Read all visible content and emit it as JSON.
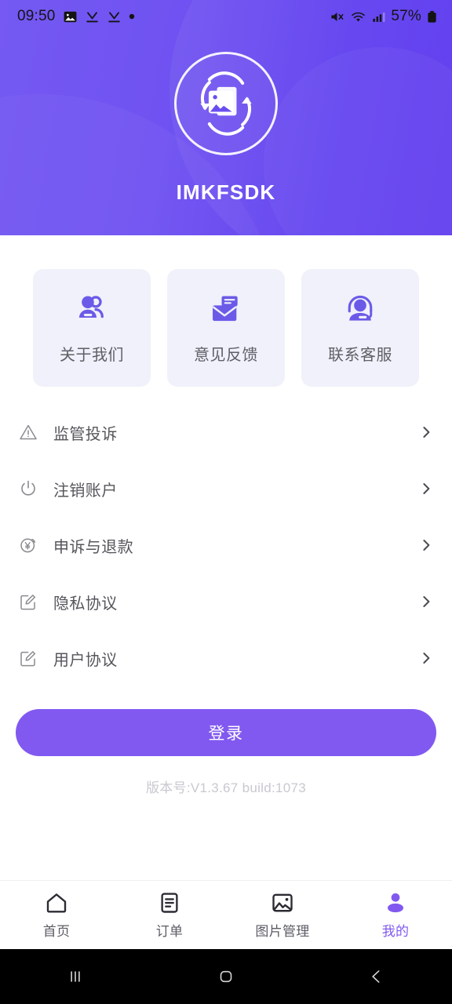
{
  "status_bar": {
    "clock": "09:50",
    "battery_text": "57%",
    "icons": [
      "image-icon",
      "download-check-icon",
      "download-check-icon",
      "dot-icon",
      "mute-icon",
      "wifi-icon",
      "signal-icon",
      "battery-icon"
    ]
  },
  "header": {
    "app_title": "IMKFSDK",
    "logo_icon": "photo-recovery-icon",
    "gradient_from": "#7559f2",
    "gradient_to": "#5a36ef"
  },
  "cards": [
    {
      "label": "关于我们",
      "icon": "users-icon"
    },
    {
      "label": "意见反馈",
      "icon": "envelope-feedback-icon"
    },
    {
      "label": "联系客服",
      "icon": "headset-support-icon"
    }
  ],
  "menu": [
    {
      "label": "监管投诉",
      "icon": "warning-triangle-icon",
      "chevron": "chevron-right-icon"
    },
    {
      "label": "注销账户",
      "icon": "power-icon",
      "chevron": "chevron-right-icon"
    },
    {
      "label": "申诉与退款",
      "icon": "refund-yen-icon",
      "chevron": "chevron-right-icon"
    },
    {
      "label": "隐私协议",
      "icon": "edit-square-icon",
      "chevron": "chevron-right-icon"
    },
    {
      "label": "用户协议",
      "icon": "edit-square-icon",
      "chevron": "chevron-right-icon"
    }
  ],
  "login": {
    "label": "登录",
    "color": "#8159f0"
  },
  "version": {
    "text": "版本号:V1.3.67 build:1073"
  },
  "tabbar": {
    "active_color": "#8159f0",
    "inactive_color": "#5c5c66",
    "items": [
      {
        "label": "首页",
        "icon": "home-icon",
        "active": false
      },
      {
        "label": "订单",
        "icon": "order-document-icon",
        "active": false
      },
      {
        "label": "图片管理",
        "icon": "image-manage-icon",
        "active": false
      },
      {
        "label": "我的",
        "icon": "person-icon",
        "active": true
      }
    ]
  },
  "android_nav": {
    "items": [
      {
        "name": "recents-button",
        "icon": "recents-icon"
      },
      {
        "name": "home-button",
        "icon": "home-square-icon"
      },
      {
        "name": "back-button",
        "icon": "back-chevron-icon"
      }
    ]
  }
}
